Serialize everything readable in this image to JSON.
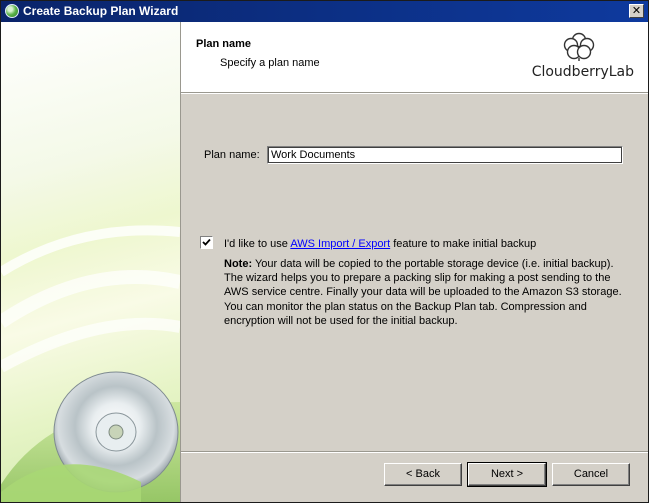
{
  "window": {
    "title": "Create Backup Plan Wizard",
    "close_glyph": "✕"
  },
  "header": {
    "title": "Plan name",
    "subtitle": "Specify a plan name",
    "logo_text": "CloudberryLab"
  },
  "form": {
    "plan_name_label": "Plan name:",
    "plan_name_value": "Work Documents",
    "import_checked": true,
    "import_text_before": "I'd like to use ",
    "import_link": "AWS Import / Export",
    "import_text_after": " feature to make initial backup"
  },
  "note": {
    "heading": "Note:",
    "line1": "  Your data will be copied to the portable storage device (i.e. initial backup).",
    "line2": "The wizard helps you to prepare a packing slip for making a post sending to the",
    "line3": "AWS service centre. Finally your data will be uploaded to the Amazon S3 storage.",
    "line4": "You can monitor the plan status on the Backup Plan tab. Compression and",
    "line5": "encryption will not be used for the initial backup."
  },
  "buttons": {
    "back": "< Back",
    "next": "Next >",
    "cancel": "Cancel"
  },
  "icons": {
    "app": "cloudberry-app-icon",
    "close": "close-icon",
    "logo": "cloud-logo-icon",
    "disc": "disc-graphic",
    "check": "checkmark-icon"
  },
  "colors": {
    "titlebar": "#0a246a",
    "link": "#0000ff",
    "dialog_bg": "#d4d0c8"
  }
}
